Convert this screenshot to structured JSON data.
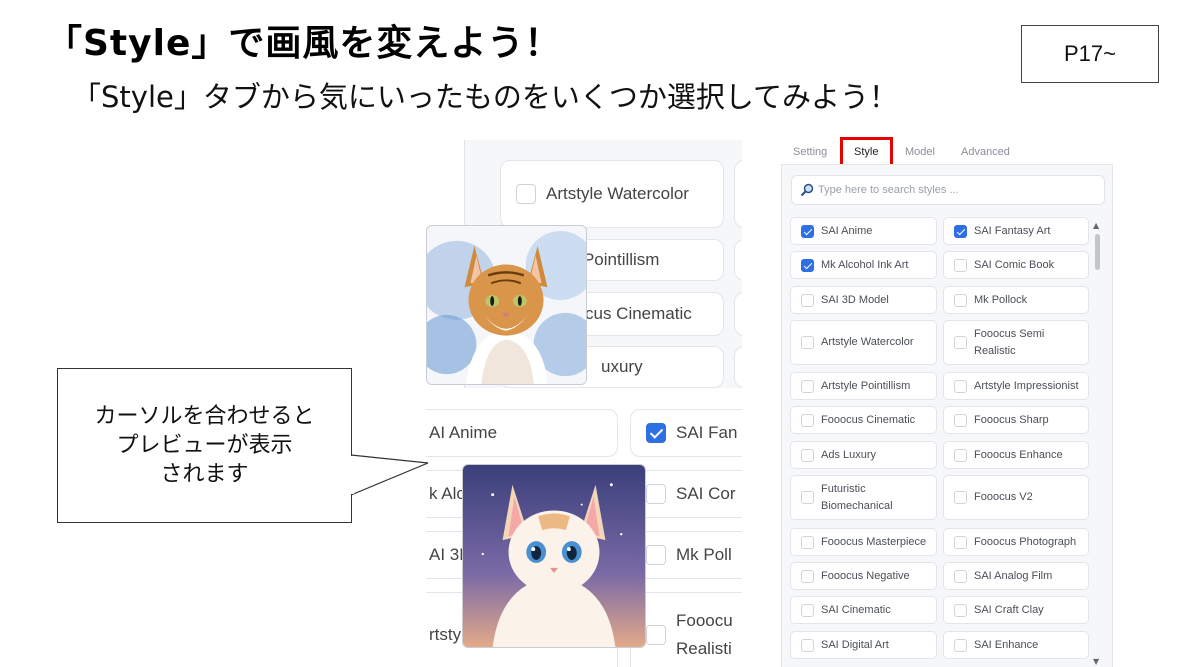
{
  "slide": {
    "title": "「Style」で画風を変えよう！",
    "subtitle": "「Style」タブから気にいったものをいくつか選択してみよう！",
    "page_ref": "P17~"
  },
  "callout": {
    "lines": [
      "カーソルを合わせると",
      "プレビューが表示",
      "されます"
    ]
  },
  "tabs": [
    {
      "label": "Setting",
      "active": false
    },
    {
      "label": "Style",
      "active": true
    },
    {
      "label": "Model",
      "active": false
    },
    {
      "label": "Advanced",
      "active": false
    }
  ],
  "search": {
    "placeholder": "Type here to search styles ..."
  },
  "styles": [
    {
      "label": "SAI Anime",
      "checked": true
    },
    {
      "label": "SAI Fantasy Art",
      "checked": true
    },
    {
      "label": "Mk Alcohol Ink Art",
      "checked": true
    },
    {
      "label": "SAI Comic Book",
      "checked": false
    },
    {
      "label": "SAI 3D Model",
      "checked": false
    },
    {
      "label": "Mk Pollock",
      "checked": false
    },
    {
      "label": "Artstyle Watercolor",
      "checked": false
    },
    {
      "label": "Fooocus Semi Realistic",
      "checked": false
    },
    {
      "label": "Artstyle Pointillism",
      "checked": false
    },
    {
      "label": "Artstyle Impressionist",
      "checked": false
    },
    {
      "label": "Fooocus Cinematic",
      "checked": false
    },
    {
      "label": "Fooocus Sharp",
      "checked": false
    },
    {
      "label": "Ads Luxury",
      "checked": false
    },
    {
      "label": "Fooocus Enhance",
      "checked": false
    },
    {
      "label": "Futuristic Biomechanical",
      "checked": false
    },
    {
      "label": "Fooocus V2",
      "checked": false
    },
    {
      "label": "Fooocus Masterpiece",
      "checked": false
    },
    {
      "label": "Fooocus Photograph",
      "checked": false
    },
    {
      "label": "Fooocus Negative",
      "checked": false
    },
    {
      "label": "SAI Analog Film",
      "checked": false
    },
    {
      "label": "SAI Cinematic",
      "checked": false
    },
    {
      "label": "SAI Craft Clay",
      "checked": false
    },
    {
      "label": "SAI Digital Art",
      "checked": false
    },
    {
      "label": "SAI Enhance",
      "checked": false
    }
  ],
  "zoom": {
    "upper": [
      {
        "label": "Artstyle Watercolor",
        "checked": false
      },
      {
        "label": "le Pointillism"
      },
      {
        "label": "cus Cinematic"
      },
      {
        "label": "uxury"
      }
    ],
    "lower": [
      {
        "label": "AI Anime"
      },
      {
        "label": "SAI Fan",
        "checked": true
      },
      {
        "label": "k Alc"
      },
      {
        "label": "SAI Cor",
        "checked": false
      },
      {
        "label": "AI 3D"
      },
      {
        "label": "Mk Poll",
        "checked": false
      },
      {
        "label": "rtsty"
      },
      {
        "label": "Fooocu Realisti",
        "checked": false
      }
    ]
  },
  "colors": {
    "accent_blue": "#2f6fe4",
    "highlight_red": "#e60000"
  }
}
